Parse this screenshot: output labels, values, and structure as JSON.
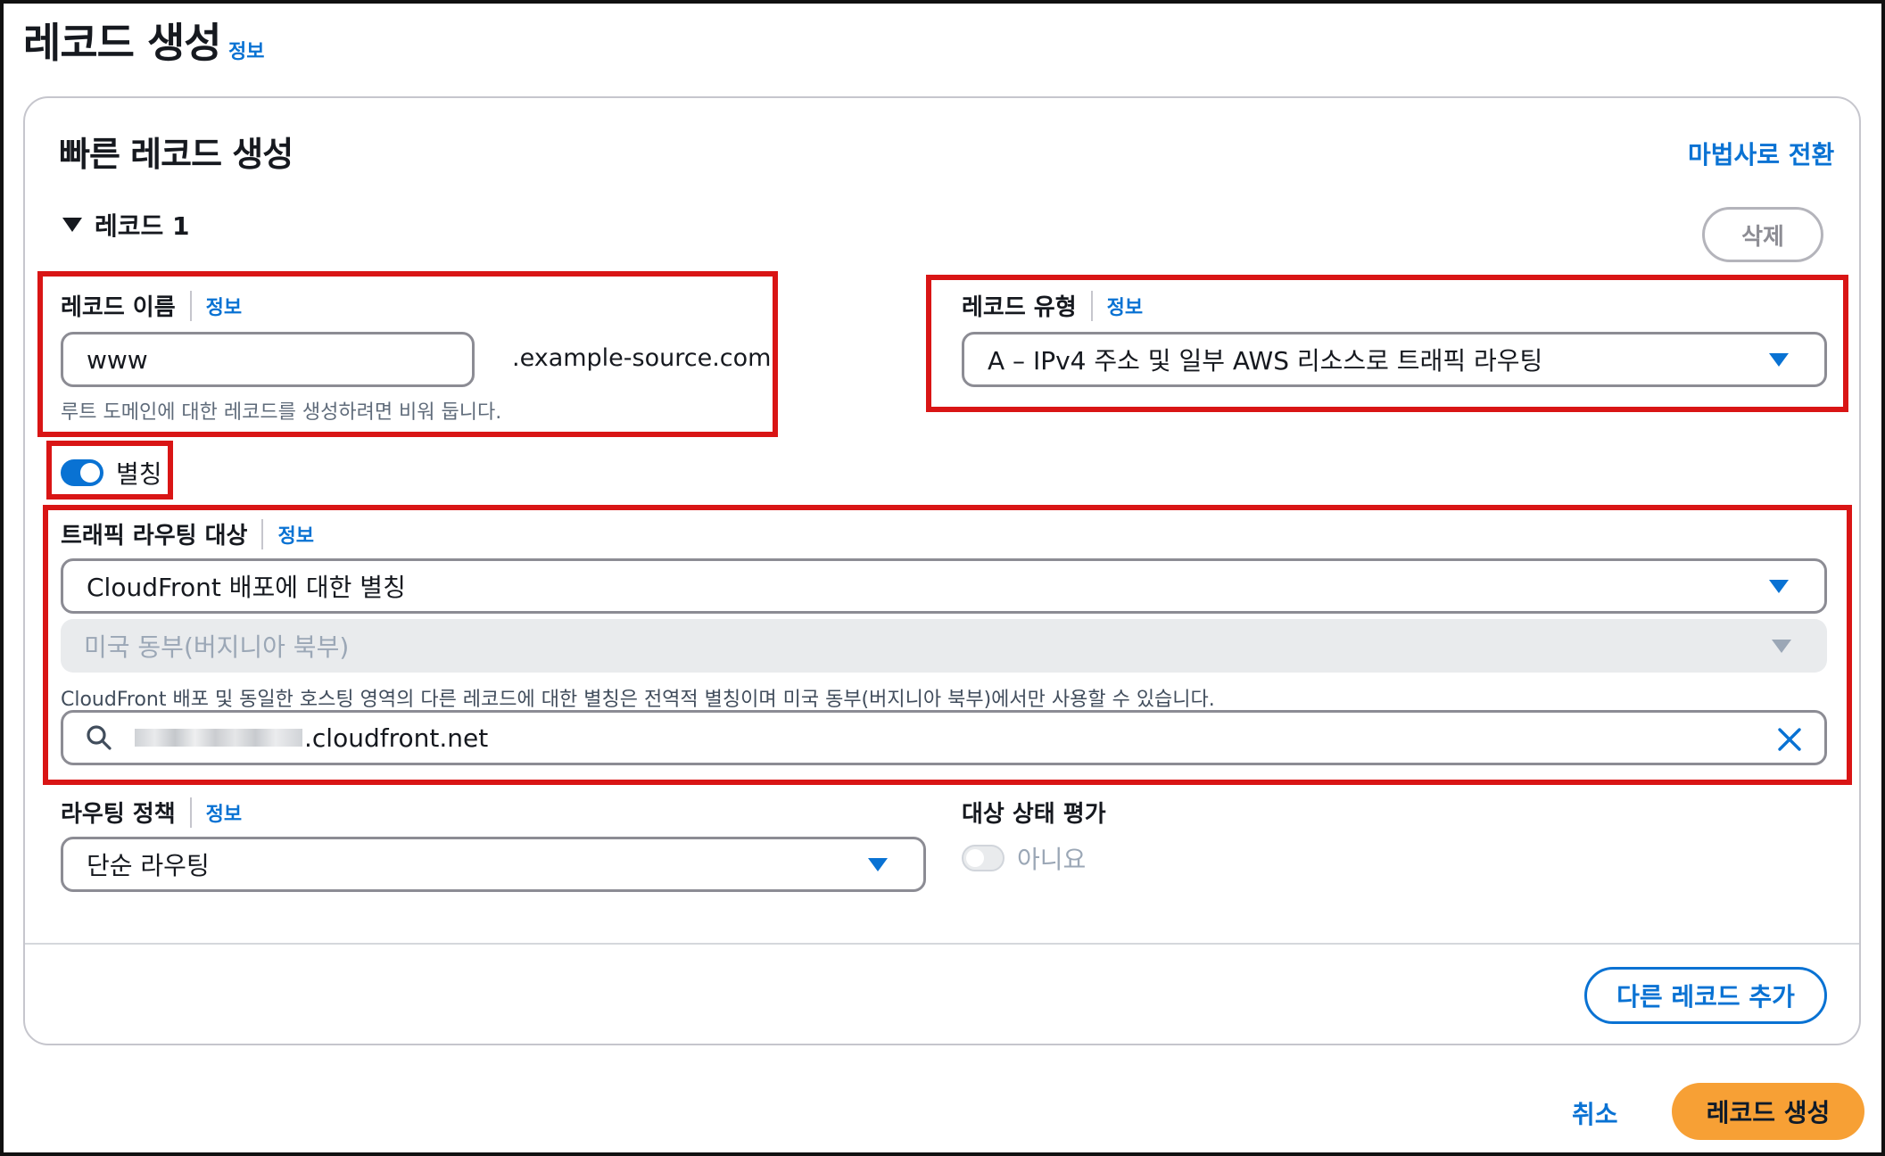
{
  "page": {
    "title": "레코드 생성",
    "info": "정보"
  },
  "panel": {
    "title": "빠른 레코드 생성",
    "wizard_link": "마법사로 전환",
    "record_toggle": "레코드 1",
    "delete_label": "삭제"
  },
  "record_name": {
    "label": "레코드 이름",
    "info": "정보",
    "value": "www",
    "suffix": ".example-source.com",
    "hint": "루트 도메인에 대한 레코드를 생성하려면 비워 둡니다."
  },
  "record_type": {
    "label": "레코드 유형",
    "info": "정보",
    "selected": "A – IPv4 주소 및 일부 AWS 리소스로 트래픽 라우팅"
  },
  "alias": {
    "label": "별칭",
    "enabled": true
  },
  "route_target": {
    "label": "트래픽 라우팅 대상",
    "info": "정보",
    "endpoint_selected": "CloudFront 배포에 대한 별칭",
    "region_selected": "미국 동부(버지니아 북부)",
    "hint": "CloudFront 배포 및 동일한 호스팅 영역의 다른 레코드에 대한 별칭은 전역적 별칭이며 미국 동부(버지니아 북부)에서만 사용할 수 있습니다.",
    "search_value": ".cloudfront.net"
  },
  "routing_policy": {
    "label": "라우팅 정책",
    "info": "정보",
    "selected": "단순 라우팅"
  },
  "health_check": {
    "label": "대상 상태 평가",
    "value": "아니요",
    "enabled": false
  },
  "actions": {
    "add_record": "다른 레코드 추가",
    "cancel": "취소",
    "create": "레코드 생성"
  },
  "colors": {
    "link_blue": "#0972d3",
    "highlight_red": "#d91515",
    "primary_orange": "#f7a035"
  },
  "icons": {
    "search": "search-icon",
    "clear": "close-icon",
    "dropdown": "caret-down-icon",
    "expand": "caret-down-icon"
  }
}
